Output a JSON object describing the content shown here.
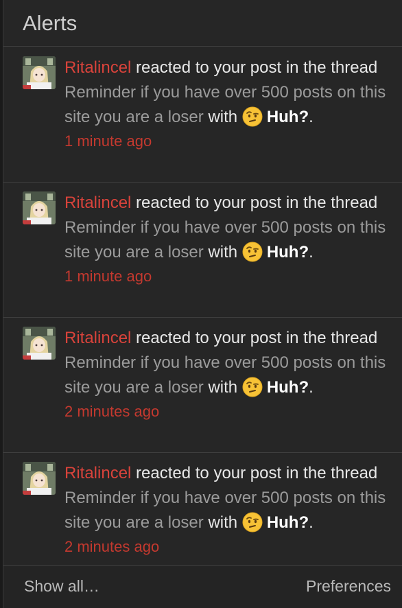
{
  "header": {
    "title": "Alerts"
  },
  "alerts": [
    {
      "user": "Ritalincel",
      "action": "reacted to your post in the thread",
      "thread": "Reminder if you have over 500 posts on this site you are a loser",
      "with_text": "with",
      "reaction": "Huh?",
      "reaction_icon": "confused-face-emoji-icon",
      "time": "1 minute ago"
    },
    {
      "user": "Ritalincel",
      "action": "reacted to your post in the thread",
      "thread": "Reminder if you have over 500 posts on this site you are a loser",
      "with_text": "with",
      "reaction": "Huh?",
      "reaction_icon": "confused-face-emoji-icon",
      "time": "1 minute ago"
    },
    {
      "user": "Ritalincel",
      "action": "reacted to your post in the thread",
      "thread": "Reminder if you have over 500 posts on this site you are a loser",
      "with_text": "with",
      "reaction": "Huh?",
      "reaction_icon": "confused-face-emoji-icon",
      "time": "2 minutes ago"
    },
    {
      "user": "Ritalincel",
      "action": "reacted to your post in the thread",
      "thread": "Reminder if you have over 500 posts on this site you are a loser",
      "with_text": "with",
      "reaction": "Huh?",
      "reaction_icon": "confused-face-emoji-icon",
      "time": "2 minutes ago"
    }
  ],
  "footer": {
    "show_all": "Show all…",
    "preferences": "Preferences"
  },
  "colors": {
    "user": "#d9433b",
    "time": "#c4392f",
    "thread": "#9b9b9b",
    "panel_bg": "#262626"
  }
}
